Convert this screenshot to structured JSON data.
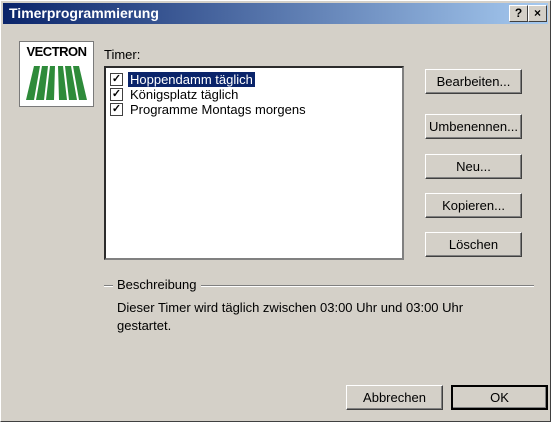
{
  "window": {
    "title": "Timerprogrammierung"
  },
  "titlebar_buttons": {
    "help": "?",
    "close": "×"
  },
  "logo": {
    "text": "VECTRON"
  },
  "timer_label": "Timer:",
  "timers": [
    {
      "label": "Hoppendamm täglich",
      "checked": true,
      "selected": true
    },
    {
      "label": "Königsplatz täglich",
      "checked": true,
      "selected": false
    },
    {
      "label": "Programme Montags morgens",
      "checked": true,
      "selected": false
    }
  ],
  "buttons": {
    "edit": "Bearbeiten...",
    "rename": "Umbenennen...",
    "new": "Neu...",
    "copy": "Kopieren...",
    "delete": "Löschen",
    "cancel": "Abbrechen",
    "ok": "OK"
  },
  "description": {
    "label": "Beschreibung",
    "text": "Dieser Timer wird täglich zwischen 03:00 Uhr und 03:00 Uhr gestartet."
  }
}
